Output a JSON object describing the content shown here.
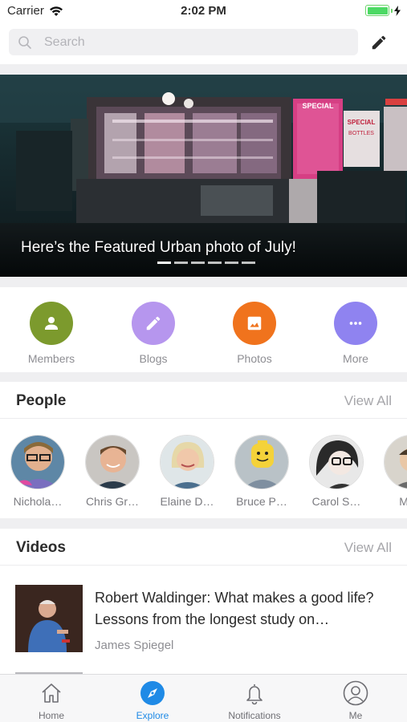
{
  "status_bar": {
    "carrier": "Carrier",
    "time": "2:02 PM"
  },
  "search": {
    "placeholder": "Search"
  },
  "hero": {
    "caption": "Here’s the Featured Urban photo of July!",
    "signs": [
      "SPECIAL",
      "SPECIAL",
      "BOTTLES"
    ],
    "pages": 6,
    "active_page": 1
  },
  "quick_actions": [
    {
      "label": "Members",
      "icon": "person-icon",
      "color": "#7c9a2d"
    },
    {
      "label": "Blogs",
      "icon": "pencil-icon",
      "color": "#b696ee"
    },
    {
      "label": "Photos",
      "icon": "image-icon",
      "color": "#f0731d"
    },
    {
      "label": "More",
      "icon": "more-dots-icon",
      "color": "#8f83f0"
    }
  ],
  "people": {
    "title": "People",
    "view_all": "View All",
    "members": [
      {
        "name": "Nichola…"
      },
      {
        "name": "Chris Gr…"
      },
      {
        "name": "Elaine D…"
      },
      {
        "name": "Bruce P…"
      },
      {
        "name": "Carol S…"
      },
      {
        "name": "Mich"
      }
    ]
  },
  "videos": {
    "title": "Videos",
    "view_all": "View All",
    "items": [
      {
        "title": "Robert Waldinger: What makes a good life? Lessons from the longest study on…",
        "author": "James Spiegel"
      }
    ]
  },
  "tab_bar": {
    "tabs": [
      {
        "label": "Home",
        "icon": "home-icon"
      },
      {
        "label": "Explore",
        "icon": "compass-icon"
      },
      {
        "label": "Notifications",
        "icon": "bell-icon"
      },
      {
        "label": "Me",
        "icon": "user-circle-icon"
      }
    ],
    "active_tab": "Explore",
    "accent": "#1f8ae6"
  }
}
